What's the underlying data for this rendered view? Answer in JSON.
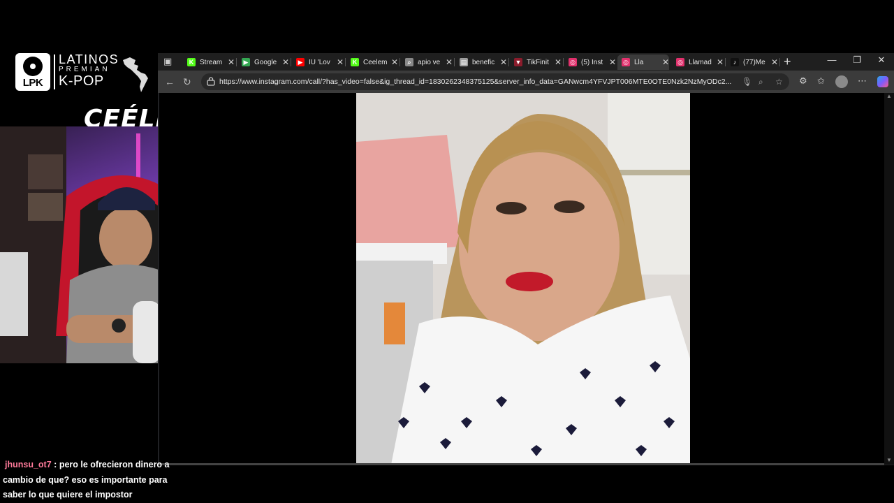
{
  "overlay": {
    "logo": {
      "badge_text": "LPK",
      "line1": "LATINOS",
      "line2": "PREMIAN",
      "line3": "K-POP"
    },
    "streamer_name": "CEÉLE"
  },
  "browser": {
    "tabs": [
      {
        "label": "Stream",
        "icon": "kick-icon",
        "color": "#53fc18"
      },
      {
        "label": "Google",
        "icon": "google-meet-icon",
        "color": "#34a853"
      },
      {
        "label": "IU 'Lov",
        "icon": "youtube-icon",
        "color": "#ff0000"
      },
      {
        "label": "Ceelem",
        "icon": "kick-icon",
        "color": "#53fc18"
      },
      {
        "label": "apio ve",
        "icon": "search-icon",
        "color": "#888888"
      },
      {
        "label": "benefic",
        "icon": "page-icon",
        "color": "#9e9e9e"
      },
      {
        "label": "TikFinit",
        "icon": "tikfinity-icon",
        "color": "#8b1c2c"
      },
      {
        "label": "(5) Inst",
        "icon": "instagram-icon",
        "color": "#e1306c"
      },
      {
        "label": "Lla",
        "icon": "instagram-icon",
        "color": "#e1306c",
        "active": true
      },
      {
        "label": "Llamad",
        "icon": "instagram-icon",
        "color": "#e1306c"
      },
      {
        "label": "(77)Me",
        "icon": "tiktok-icon",
        "color": "#111111"
      }
    ],
    "url": "https://www.instagram.com/call/?has_video=false&ig_thread_id=1830262348375125&server_info_data=GANwcm4YFVJPT006MTE0OTE0Nzk2NzMyODc2..."
  },
  "chat": {
    "username": "jhunsu_ot7",
    "separator": ":",
    "message": "pero le ofrecieron dinero a cambio de que? eso es importante para saber lo que quiere el impostor"
  }
}
